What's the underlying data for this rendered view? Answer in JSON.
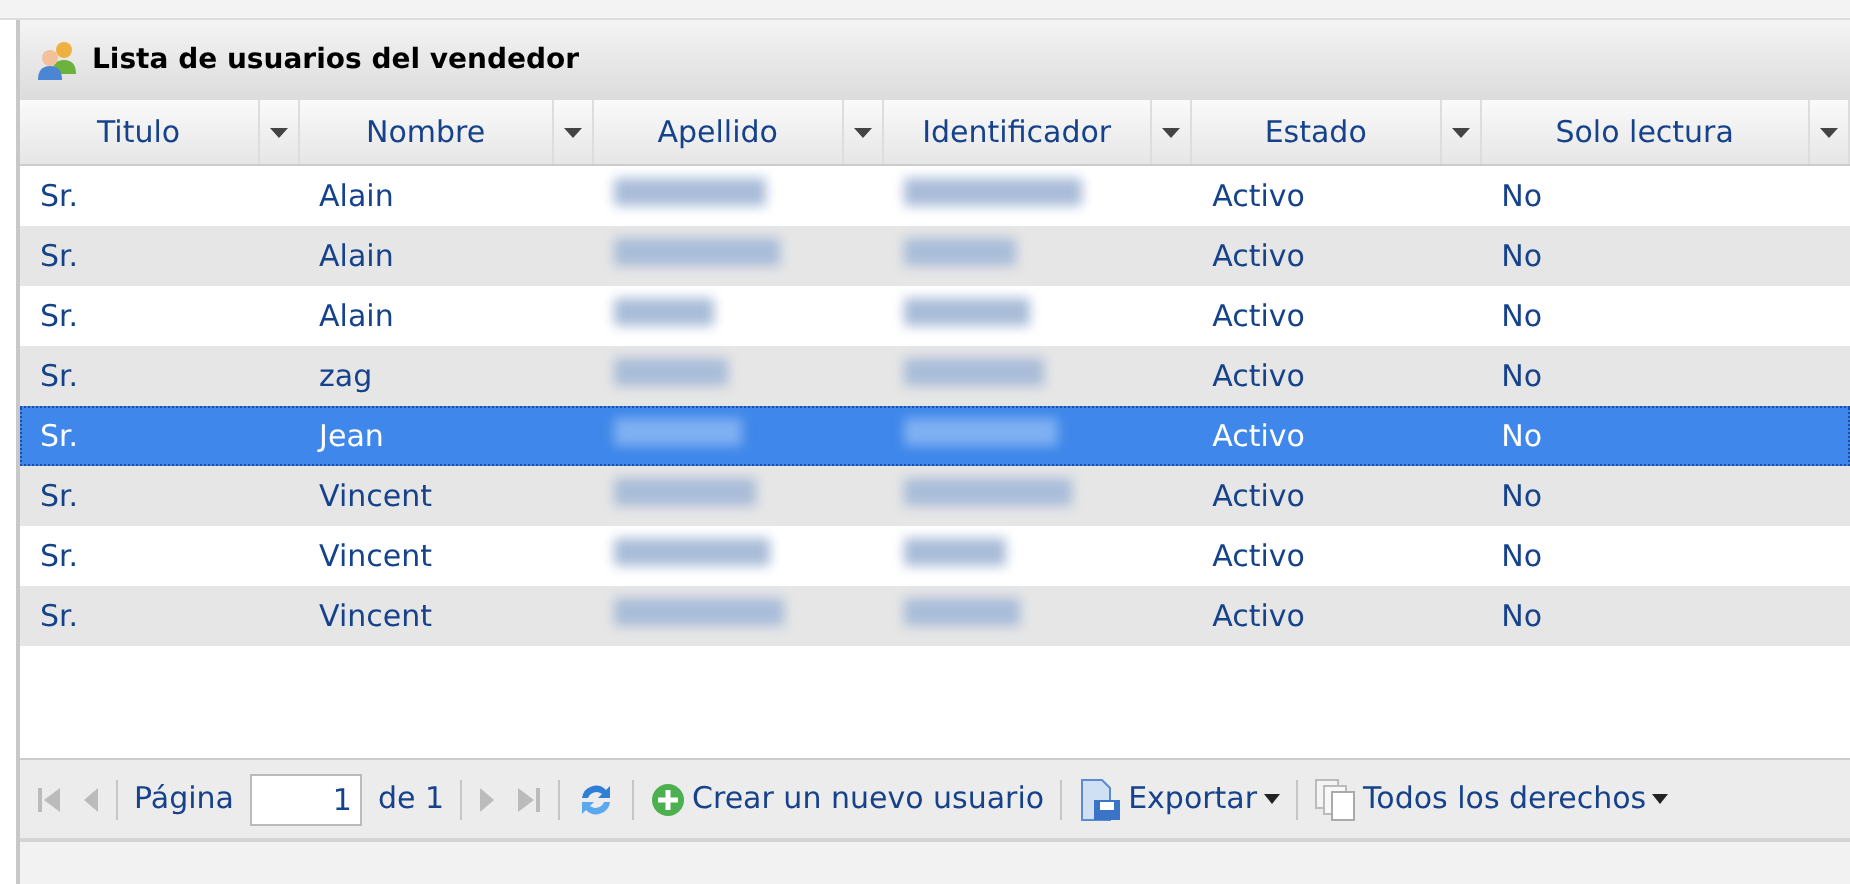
{
  "panel": {
    "title": "Lista de usuarios del vendedor"
  },
  "table": {
    "columns": [
      {
        "label": "Titulo",
        "kind": "text"
      },
      {
        "label": "Nombre",
        "kind": "text"
      },
      {
        "label": "Apellido",
        "kind": "blurred"
      },
      {
        "label": "Identificador",
        "kind": "blurred"
      },
      {
        "label": "Estado",
        "kind": "text"
      },
      {
        "label": "Solo lectura",
        "kind": "text"
      }
    ],
    "rows": [
      {
        "cells": [
          "Sr.",
          "Alain",
          "",
          "",
          "Activo",
          "No"
        ],
        "selected": false
      },
      {
        "cells": [
          "Sr.",
          "Alain",
          "",
          "",
          "Activo",
          "No"
        ],
        "selected": false
      },
      {
        "cells": [
          "Sr.",
          "Alain",
          "",
          "",
          "Activo",
          "No"
        ],
        "selected": false
      },
      {
        "cells": [
          "Sr.",
          "zag",
          "",
          "",
          "Activo",
          "No"
        ],
        "selected": false
      },
      {
        "cells": [
          "Sr.",
          "Jean",
          "",
          "",
          "Activo",
          "No"
        ],
        "selected": true
      },
      {
        "cells": [
          "Sr.",
          "Vincent",
          "",
          "",
          "Activo",
          "No"
        ],
        "selected": false
      },
      {
        "cells": [
          "Sr.",
          "Vincent",
          "",
          "",
          "Activo",
          "No"
        ],
        "selected": false
      },
      {
        "cells": [
          "Sr.",
          "Vincent",
          "",
          "",
          "Activo",
          "No"
        ],
        "selected": false
      }
    ]
  },
  "pager": {
    "page_label": "Página",
    "page_value": "1",
    "of_label": "de 1"
  },
  "toolbar": [
    {
      "kind": "create",
      "label": "Crear un nuevo usuario"
    },
    {
      "kind": "export",
      "label": "Exportar"
    },
    {
      "kind": "rights",
      "label": "Todos los derechos"
    }
  ]
}
